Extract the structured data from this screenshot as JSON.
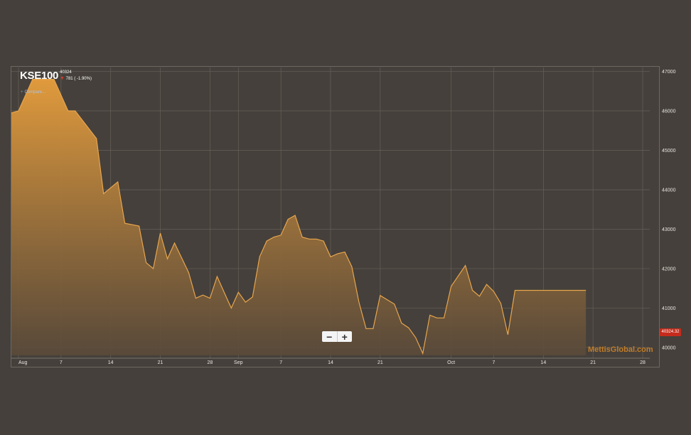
{
  "header": {
    "symbol": "KSE100",
    "price": "40324",
    "change": "781 ( -1.90%)",
    "compare_label": "Compare..."
  },
  "zoom": {
    "minus": "−",
    "plus": "+"
  },
  "watermark": "MettisGlobal.com",
  "last_price_label": "40324.32",
  "colors": {
    "background": "#45403b",
    "area_top": "#e09a3c",
    "area_bottom": "#5a4a3a",
    "line": "#e8a54c",
    "last_price_badge": "#c42b1c",
    "down_arrow": "#d93a2b"
  },
  "chart_data": {
    "type": "area",
    "title": "KSE100",
    "x_ticks": [
      {
        "label": "Aug",
        "day": 1
      },
      {
        "label": "7",
        "day": 7
      },
      {
        "label": "14",
        "day": 14
      },
      {
        "label": "21",
        "day": 21
      },
      {
        "label": "28",
        "day": 28
      },
      {
        "label": "Sep",
        "day": 32
      },
      {
        "label": "7",
        "day": 38
      },
      {
        "label": "14",
        "day": 45
      },
      {
        "label": "21",
        "day": 52
      },
      {
        "label": "Oct",
        "day": 62
      },
      {
        "label": "7",
        "day": 68
      },
      {
        "label": "14",
        "day": 75
      },
      {
        "label": "21",
        "day": 82
      },
      {
        "label": "28",
        "day": 89
      }
    ],
    "y_ticks": [
      40000,
      41000,
      42000,
      43000,
      44000,
      45000,
      46000,
      47000
    ],
    "ylim": [
      39800,
      47100
    ],
    "xlim": [
      0,
      90
    ],
    "grid": true,
    "series": [
      {
        "x": [
          0,
          1,
          3,
          4,
          5,
          6,
          8,
          9,
          12,
          13,
          15,
          16,
          18,
          19,
          20,
          21,
          22,
          23,
          25,
          26,
          27,
          28,
          29,
          30,
          31,
          32,
          33,
          34,
          35,
          36,
          37,
          38,
          39,
          40,
          41,
          42,
          43,
          44,
          45,
          46,
          47,
          48,
          49,
          50,
          51,
          52,
          54,
          55,
          56,
          57,
          58,
          59,
          60,
          61,
          62,
          64,
          65,
          66,
          67,
          68,
          69,
          70,
          71,
          72,
          73,
          75,
          76,
          77,
          78,
          79,
          80,
          81,
          82,
          83,
          84,
          85,
          86,
          87,
          88,
          89
        ],
        "values": [
          45950,
          46000,
          46800,
          46800,
          46800,
          46800,
          46000,
          46000,
          45300,
          43900,
          44200,
          43150,
          43080,
          42150,
          42000,
          42900,
          42250,
          42650,
          41900,
          41250,
          41330,
          41250,
          41800,
          41400,
          41000,
          41400,
          41150,
          41280,
          42300,
          42700,
          42800,
          42850,
          43250,
          43350,
          42800,
          42750,
          42750,
          42700,
          42300,
          42380,
          42420,
          42050,
          41150,
          40480,
          40480,
          41320,
          41100,
          40620,
          40500,
          40250,
          39850,
          40820,
          40750,
          40750,
          41550,
          42080,
          41450,
          41300,
          41600,
          41420,
          41120,
          40324,
          41450,
          41450,
          41450,
          41450,
          41450,
          41450,
          41450,
          41450,
          41450,
          41450,
          41450,
          41450,
          41450,
          41450,
          41450,
          41450,
          41450,
          41450
        ]
      }
    ]
  }
}
